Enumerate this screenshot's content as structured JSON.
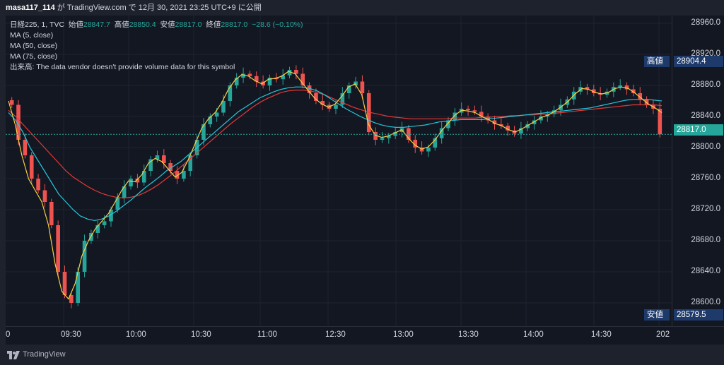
{
  "header": {
    "user": "masa117_114",
    "text": " が TradingView.com で 12月 30, 2021 23:25 UTC+9 に公開"
  },
  "legend": {
    "symbol": "日経225, 1, TVC",
    "open_label": "始値",
    "open": "28847.7",
    "high_label": "高値",
    "high": "28850.4",
    "low_label": "安値",
    "low": "28817.0",
    "close_label": "終値",
    "close": "28817.0",
    "change": "−28.6 (−0.10%)",
    "ma5": "MA (5, close)",
    "ma50": "MA (50, close)",
    "ma75": "MA (75, close)",
    "volume_note": "出来高: The data vendor doesn't provide volume data for this symbol"
  },
  "price_scale": {
    "ticks": [
      "28960.0",
      "28920.0",
      "28880.0",
      "28840.0",
      "28800.0",
      "28760.0",
      "28720.0",
      "28680.0",
      "28640.0",
      "28600.0"
    ],
    "tick_values": [
      28960,
      28920,
      28880,
      28840,
      28800,
      28760,
      28720,
      28680,
      28640,
      28600
    ],
    "high_tag_label": "高値",
    "high_tag_value": "28904.4",
    "last_price": "28817.0",
    "low_tag_label": "安値",
    "low_tag_value": "28579.5"
  },
  "time_scale": {
    "labels": [
      "0",
      "09:30",
      "10:00",
      "10:30",
      "11:00",
      "12:30",
      "13:00",
      "13:30",
      "14:00",
      "14:30",
      "202"
    ]
  },
  "footer": {
    "brand": "TradingView"
  },
  "colors": {
    "background": "#131722",
    "up": "#26a69a",
    "down": "#ef5350",
    "ma5": "#f7d046",
    "ma50": "#26c6da",
    "ma75": "#e53935"
  },
  "chart_data": {
    "type": "candlestick",
    "symbol": "日経225",
    "ylim": [
      28570,
      28970
    ],
    "close_series": [
      28855,
      28810,
      28790,
      28760,
      28745,
      28730,
      28700,
      28640,
      28610,
      28600,
      28640,
      28680,
      28690,
      28700,
      28705,
      28720,
      28735,
      28750,
      28760,
      28755,
      28770,
      28785,
      28790,
      28780,
      28770,
      28760,
      28770,
      28790,
      28810,
      28830,
      28840,
      28845,
      28860,
      28880,
      28890,
      28895,
      28892,
      28885,
      28880,
      28890,
      28888,
      28893,
      28900,
      28895,
      28880,
      28870,
      28860,
      28855,
      28850,
      28855,
      28870,
      28880,
      28885,
      28870,
      28820,
      28810,
      28812,
      28815,
      28820,
      28825,
      28810,
      28800,
      28795,
      28800,
      28812,
      28825,
      28835,
      28845,
      28850,
      28848,
      28846,
      28840,
      28835,
      28830,
      28828,
      28822,
      28818,
      28825,
      28830,
      28835,
      28840,
      28843,
      28848,
      28855,
      28862,
      28872,
      28878,
      28875,
      28870,
      28868,
      28872,
      28878,
      28880,
      28875,
      28870,
      28862,
      28855,
      28850,
      28817
    ],
    "ma5_series": [
      28860,
      28830,
      28790,
      28760,
      28745,
      28730,
      28700,
      28650,
      28615,
      28605,
      28625,
      28660,
      28680,
      28695,
      28705,
      28715,
      28730,
      28745,
      28757,
      28756,
      28765,
      28780,
      28786,
      28782,
      28772,
      28762,
      28768,
      28785,
      28805,
      28825,
      28837,
      28845,
      28858,
      28875,
      28887,
      28894,
      28892,
      28886,
      28882,
      28888,
      28889,
      28892,
      28898,
      28895,
      28884,
      28873,
      28863,
      28856,
      28852,
      28856,
      28866,
      28878,
      28882,
      28868,
      28830,
      28816,
      28813,
      28815,
      28819,
      28823,
      28812,
      28803,
      28798,
      28801,
      28810,
      28822,
      28832,
      28842,
      28848,
      28847,
      28845,
      28840,
      28836,
      28831,
      28828,
      28823,
      28820,
      28824,
      28829,
      28834,
      28839,
      28842,
      28847,
      28853,
      28860,
      28869,
      28876,
      28875,
      28871,
      28869,
      28871,
      28876,
      28878,
      28876,
      28870,
      28863,
      28856,
      28851,
      28845
    ],
    "ma50_series": [
      28845,
      28835,
      28820,
      28800,
      28785,
      28770,
      28755,
      28740,
      28730,
      28720,
      28712,
      28708,
      28706,
      28708,
      28712,
      28718,
      28725,
      28732,
      28740,
      28748,
      28755,
      28762,
      28770,
      28776,
      28782,
      28790,
      28798,
      28806,
      28814,
      28822,
      28830,
      28838,
      28846,
      28852,
      28858,
      28864,
      28868,
      28872,
      28875,
      28877,
      28878,
      28878,
      28876,
      28873,
      28868,
      28862,
      28856,
      28850,
      28845,
      28840,
      28836,
      28832,
      28829,
      28827,
      28826,
      28826,
      28827,
      28828,
      28829,
      28831,
      28833,
      28834,
      28835,
      28836,
      28836,
      28836,
      28836,
      28837,
      28838,
      28839,
      28840,
      28841,
      28842,
      28843,
      28844,
      28845,
      28846,
      28847,
      28848,
      28849,
      28850,
      28851,
      28853,
      28855,
      28857,
      28859,
      28861,
      28862,
      28862,
      28862,
      28861,
      28860
    ],
    "ma75_series": [
      28848,
      28840,
      28830,
      28820,
      28810,
      28800,
      28790,
      28780,
      28770,
      28762,
      28756,
      28750,
      28745,
      28741,
      28738,
      28736,
      28735,
      28736,
      28738,
      28742,
      28747,
      28753,
      28760,
      28767,
      28775,
      28783,
      28791,
      28799,
      28807,
      28815,
      28823,
      28831,
      28838,
      28845,
      28852,
      28858,
      28863,
      28867,
      28871,
      28873,
      28874,
      28874,
      28873,
      28871,
      28868,
      28864,
      28860,
      28856,
      28852,
      28849,
      28846,
      28844,
      28842,
      28840,
      28839,
      28838,
      28837,
      28837,
      28837,
      28837,
      28837,
      28837,
      28838,
      28838,
      28838,
      28838,
      28839,
      28839,
      28840,
      28840,
      28841,
      28841,
      28842,
      28842,
      28843,
      28843,
      28844,
      28845,
      28846,
      28847,
      28848,
      28849,
      28850,
      28851,
      28852,
      28853,
      28854,
      28855,
      28855,
      28855,
      28855,
      28854
    ],
    "high": 28904.4,
    "low": 28579.5,
    "last": 28817.0
  }
}
